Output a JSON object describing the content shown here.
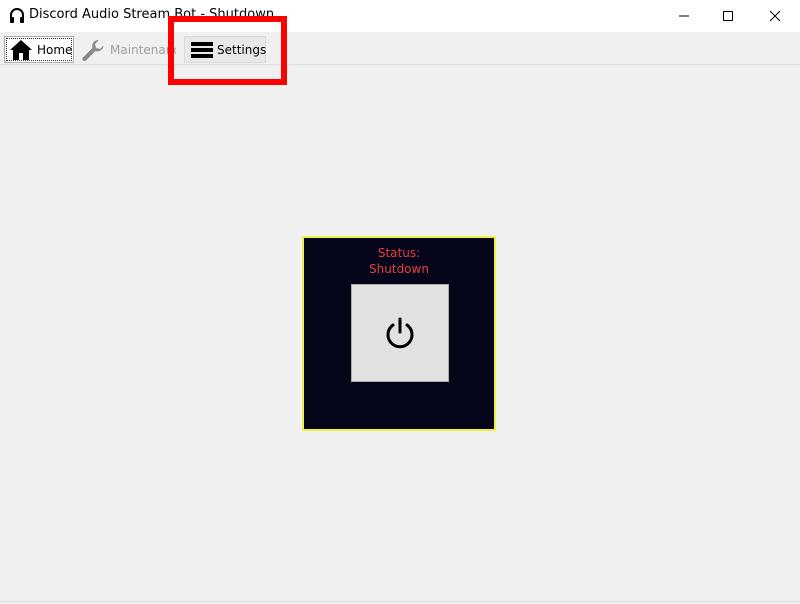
{
  "window": {
    "title": "Discord Audio Stream Bot - Shutdown",
    "app_icon": "headphones-icon",
    "controls": {
      "minimize": "minimize-icon",
      "maximize": "maximize-icon",
      "close": "close-icon"
    }
  },
  "tabs": [
    {
      "label": "Home",
      "icon": "home-icon",
      "state": "selected"
    },
    {
      "label": "Maintenance",
      "icon": "wrench-icon",
      "state": "disabled"
    },
    {
      "label": "Settings",
      "icon": "hamburger-menu-icon",
      "state": "normal"
    }
  ],
  "status_panel": {
    "label": "Status:",
    "value": "Shutdown",
    "power_button_icon": "power-icon"
  },
  "colors": {
    "panel_background": "#06061a",
    "panel_border": "#f0f040",
    "status_text": "#e34040",
    "highlight": "#ff0000"
  }
}
